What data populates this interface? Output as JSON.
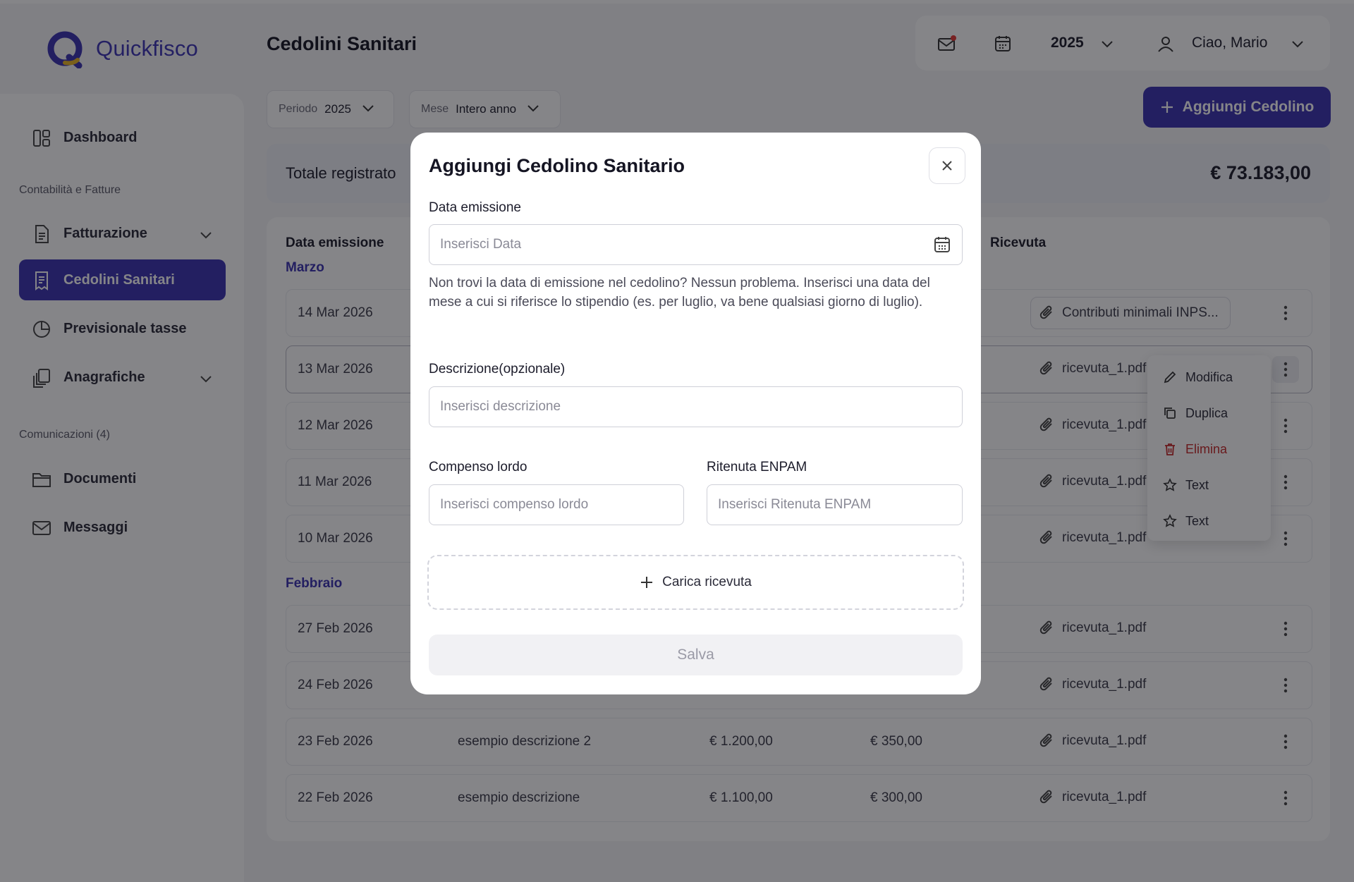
{
  "app": {
    "name": "Quickfisco",
    "page_title": "Cedolini Sanitari"
  },
  "header": {
    "year": "2025",
    "greeting": "Ciao, Mario"
  },
  "sidebar": {
    "items": [
      {
        "label": "Dashboard"
      },
      {
        "label": "Fatturazione"
      },
      {
        "label": "Cedolini Sanitari"
      },
      {
        "label": "Previsionale tasse"
      },
      {
        "label": "Anagrafiche"
      },
      {
        "label": "Documenti"
      },
      {
        "label": "Messaggi"
      }
    ],
    "sections": [
      "Contabilità e Fatture",
      "Comunicazioni (4)"
    ]
  },
  "filters": {
    "periodo": {
      "label": "Periodo",
      "value": "2025"
    },
    "mese": {
      "label": "Mese",
      "value": "Intero anno"
    }
  },
  "actions": {
    "add_label": "Aggiungi Cedolino"
  },
  "totals": {
    "label": "Totale registrato",
    "value": "€ 73.183,00"
  },
  "table": {
    "columns": {
      "date": "Data emissione",
      "file": "Ricevuta"
    },
    "months": [
      "Marzo",
      "Febbraio"
    ],
    "rows": [
      {
        "date": "14 Mar 2026",
        "desc": "",
        "lordo": "",
        "enpam": "",
        "file": "Contributi minimali INPS..."
      },
      {
        "date": "13 Mar 2026",
        "desc": "",
        "lordo": "",
        "enpam": "",
        "file": "ricevuta_1.pdf"
      },
      {
        "date": "12 Mar 2026",
        "desc": "",
        "lordo": "",
        "enpam": "",
        "file": "ricevuta_1.pdf"
      },
      {
        "date": "11 Mar 2026",
        "desc": "",
        "lordo": "",
        "enpam": "",
        "file": "ricevuta_1.pdf"
      },
      {
        "date": "10 Mar 2026",
        "desc": "",
        "lordo": "",
        "enpam": "",
        "file": "ricevuta_1.pdf"
      },
      {
        "date": "27 Feb 2026",
        "desc": "",
        "lordo": "",
        "enpam": "",
        "file": "ricevuta_1.pdf"
      },
      {
        "date": "24 Feb 2026",
        "desc": "",
        "lordo": "",
        "enpam": "",
        "file": "ricevuta_1.pdf"
      },
      {
        "date": "23 Feb 2026",
        "desc": "esempio descrizione 2",
        "lordo": "€ 1.200,00",
        "enpam": "€ 350,00",
        "file": "ricevuta_1.pdf"
      },
      {
        "date": "22 Feb 2026",
        "desc": "esempio descrizione",
        "lordo": "€ 1.100,00",
        "enpam": "€ 300,00",
        "file": "ricevuta_1.pdf"
      }
    ]
  },
  "context_menu": {
    "items": [
      {
        "label": "Modifica",
        "icon": "pencil-icon"
      },
      {
        "label": "Duplica",
        "icon": "copy-icon"
      },
      {
        "label": "Elimina",
        "icon": "trash-icon"
      },
      {
        "label": "Text",
        "icon": "star-icon"
      },
      {
        "label": "Text",
        "icon": "star-icon"
      }
    ]
  },
  "modal": {
    "title": "Aggiungi Cedolino Sanitario",
    "date_label": "Data emissione",
    "date_placeholder": "Inserisci Data",
    "hint": "Non trovi la data di emissione nel cedolino? Nessun problema. Inserisci una data del mese a cui si riferisce lo stipendio (es. per luglio, va bene qualsiasi giorno di luglio).",
    "desc_label": "Descrizione(opzionale)",
    "desc_placeholder": "Inserisci descrizione",
    "lordo_label": "Compenso lordo",
    "lordo_placeholder": "Inserisci compenso lordo",
    "enpam_label": "Ritenuta ENPAM",
    "enpam_placeholder": "Inserisci Ritenuta ENPAM",
    "upload_label": "Carica ricevuta",
    "save_label": "Salva"
  },
  "colors": {
    "accent": "#3b33b0",
    "logo_accent": "#e8b524",
    "danger": "#c62828",
    "notification": "#e53935"
  }
}
